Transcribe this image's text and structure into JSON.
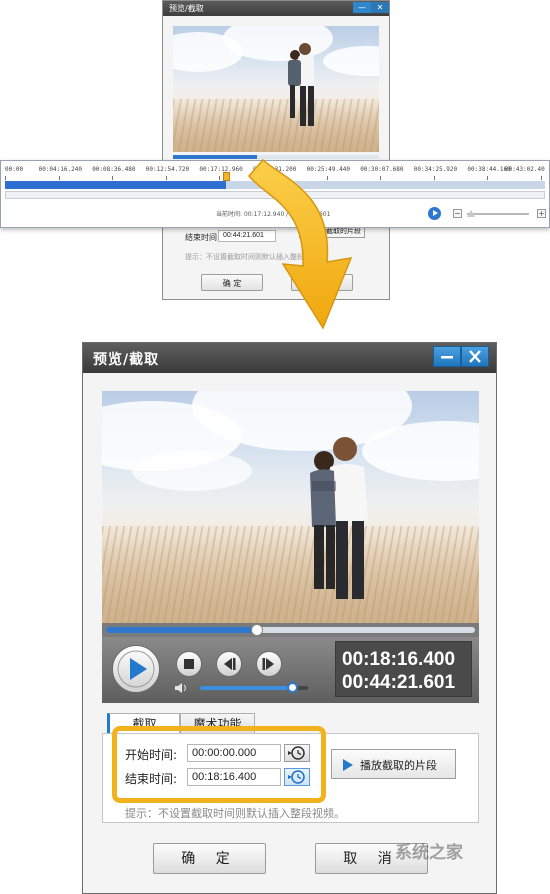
{
  "window": {
    "title": "预览/截取",
    "minimize_label": "—",
    "close_label": "✕"
  },
  "player": {
    "current_time": "00:18:16.400",
    "total_time": "00:44:21.601",
    "progress": 0.41,
    "volume": 0.85
  },
  "tabs": [
    {
      "label": "截取",
      "active": true
    },
    {
      "label": "魔术功能",
      "active": false
    }
  ],
  "clip": {
    "start_label": "开始时间:",
    "start_value": "00:00:00.000",
    "end_label": "结束时间:",
    "end_value": "00:18:16.400",
    "play_segment_label": "播放截取的片段",
    "hint": "提示：不设置截取时间则默认插入整段视频。"
  },
  "buttons": {
    "ok_label": "确 定",
    "cancel_label": "取 消"
  },
  "small_window": {
    "title": "预览/截取",
    "end_label": "结束时间:",
    "end_value": "00:44:21.601",
    "play_segment_label": "播放截取的片段",
    "hint": "提示：不设置截取时间则默认插入整段视频。",
    "ok_label": "确 定",
    "cancel_label": "取 消"
  },
  "timeline": {
    "ticks": [
      "00:00",
      "00:04:16.240",
      "00:08:36.480",
      "00:12:54.720",
      "00:17:12.960",
      "00:21:31.200",
      "00:25:49.440",
      "00:30:07.680",
      "00:34:25.920",
      "00:38:44.160",
      "00:43:02.40"
    ],
    "readout_label": "当前时间:",
    "readout_current": "00:17:12.940",
    "readout_total": "00:44:21.601",
    "progress": 0.41
  },
  "colors": {
    "accent": "#1e7bd2",
    "highlight": "#f2b21d",
    "titlebar": "#4a4a4a"
  },
  "watermark": "系统之家"
}
